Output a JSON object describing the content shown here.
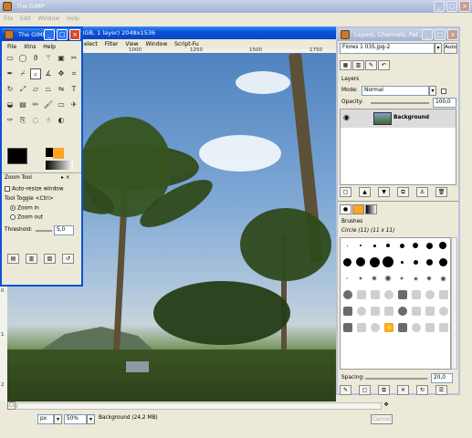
{
  "main_window": {
    "title": "The GIMP",
    "menus": [
      "File",
      "Edit",
      "Window",
      "Help"
    ]
  },
  "image_window": {
    "title": "RGB, 1 layer) 2048x1536",
    "menus": [
      "elect",
      "Filter",
      "View",
      "Window",
      "Script-Fu"
    ],
    "ruler_top": [
      "1000",
      "1250",
      "1500",
      "1750"
    ],
    "ruler_left": [
      "0",
      "1",
      "2"
    ],
    "unit": "px",
    "zoom": "50%",
    "status": "Background (24,2 MB)",
    "cancel_label": "Cancel"
  },
  "toolbox": {
    "title": "The GIMP",
    "menus": [
      "File",
      "Xtns",
      "Help"
    ],
    "tool_icons": [
      "rect-select-icon",
      "ellipse-select-icon",
      "lasso-icon",
      "fuzzy-select-icon",
      "color-select-icon",
      "scissors-icon",
      "paths-icon",
      "color-picker-icon",
      "zoom-icon",
      "measure-icon",
      "move-icon",
      "crop-icon",
      "rotate-icon",
      "scale-icon",
      "shear-icon",
      "perspective-icon",
      "flip-icon",
      "text-icon",
      "bucket-fill-icon",
      "blend-icon",
      "pencil-icon",
      "paintbrush-icon",
      "eraser-icon",
      "airbrush-icon",
      "ink-icon",
      "clone-icon",
      "convolve-icon",
      "smudge-icon",
      "dodge-icon"
    ],
    "text_tool_glyph": "T",
    "fg_color": "#000000",
    "bg_color": "#ffffff",
    "gradient_colors": [
      "#ffa424",
      "#ffe9c4"
    ]
  },
  "zoom_tool": {
    "title": "Zoom Tool",
    "auto_resize": "Auto-resize window",
    "toggle_label": "Tool Toggle  <Ctrl>",
    "zoom_in": "Zoom in",
    "zoom_out": "Zoom out",
    "threshold_label": "Threshold:",
    "threshold_value": "5,0"
  },
  "layers_window": {
    "title": "Layers, Channels, Pat...",
    "image_select": "Flores 1 035.jpg-2",
    "auto_label": "Auto",
    "section_title": "Layers",
    "mode_label": "Mode:",
    "mode_value": "Normal",
    "opacity_label": "Opacity:",
    "opacity_value": "100,0",
    "layer_name": "Background",
    "brushes_title": "Brushes",
    "brush_name": "Circle (11) (11 x 11)",
    "spacing_label": "Spacing:",
    "spacing_value": "20,0"
  },
  "desktop": {
    "background_title": "The GIMP",
    "background_menus": [
      "File",
      "Edit",
      "Window",
      "Help"
    ]
  }
}
